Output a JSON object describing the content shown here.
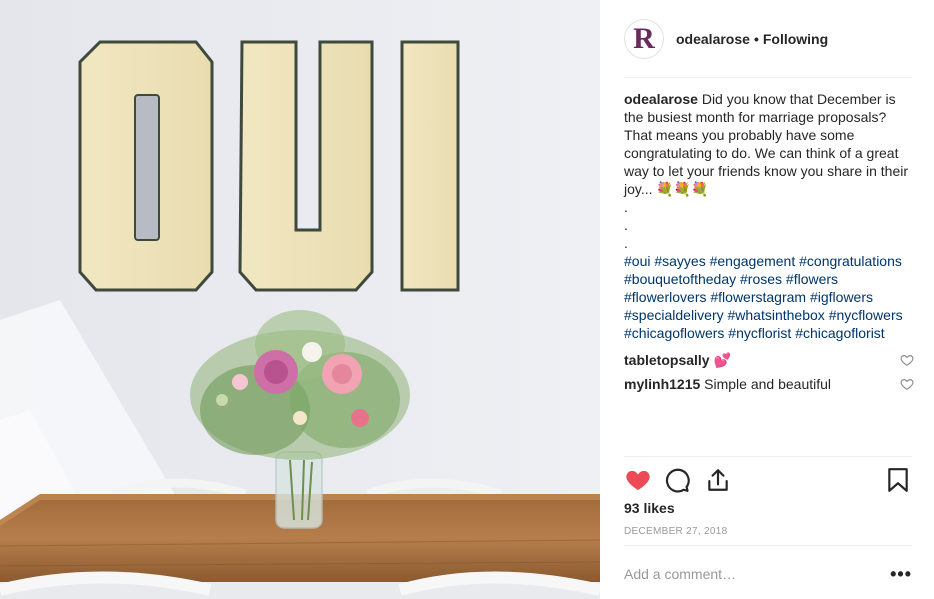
{
  "post": {
    "username": "odealarose",
    "follow_status": "Following",
    "separator": "•",
    "avatar_letter": "R",
    "caption_user": "odealarose",
    "caption_text": "Did you know that December is the busiest month for marriage proposals? That means you probably have some congratulating to do. We can think of a great way to let your friends know you share in their joy... 💐💐💐",
    "caption_dots": [
      ".",
      ".",
      "."
    ],
    "hashtags": [
      "#oui",
      "#sayyes",
      "#engagement",
      "#congratulations",
      "#bouquetoftheday",
      "#roses",
      "#flowers",
      "#flowerlovers",
      "#flowerstagram",
      "#igflowers",
      "#specialdelivery",
      "#whatsinthebox",
      "#nycflowers",
      "#chicagoflowers",
      "#nycflorist",
      "#chicagoflorist"
    ],
    "comments": [
      {
        "user": "tabletopsally",
        "text": "💕"
      },
      {
        "user": "mylinh1215",
        "text": "Simple and beautiful"
      }
    ],
    "likes": "93 likes",
    "date": "DECEMBER 27, 2018",
    "add_comment_placeholder": "Add a comment…",
    "more_label": "•••",
    "liked": true
  },
  "photo": {
    "wall_sign_text": "OUI",
    "alt": "photo"
  },
  "icons": {
    "like": "heart-icon",
    "comment": "comment-icon",
    "share": "share-icon",
    "save": "bookmark-icon"
  },
  "colors": {
    "like_red": "#ed4956",
    "hashtag_blue": "#003569",
    "muted_gray": "#999999"
  }
}
